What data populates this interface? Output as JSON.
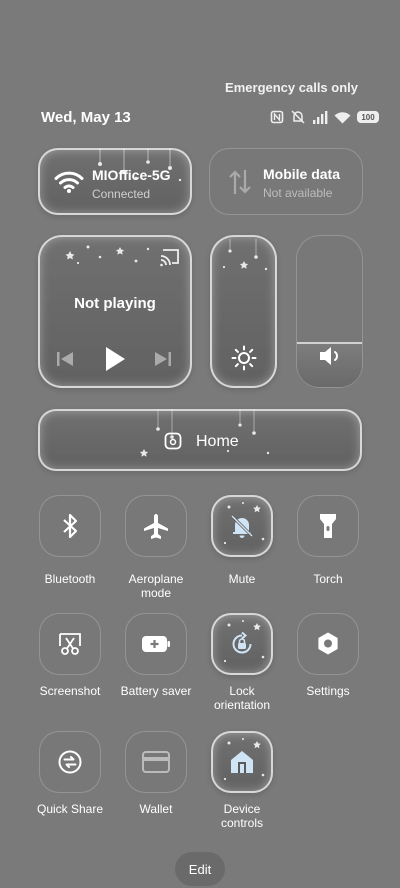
{
  "status": {
    "carrier_text": "Emergency calls only",
    "date": "Wed, May 13",
    "battery": "100"
  },
  "wifi": {
    "name": "MIOffice-5G",
    "status": "Connected"
  },
  "mobile_data": {
    "title": "Mobile data",
    "status": "Not available"
  },
  "media": {
    "status": "Not playing"
  },
  "home": {
    "label": "Home"
  },
  "levels": {
    "brightness": 0.0,
    "volume": 0.2
  },
  "toggles": [
    {
      "label": "Bluetooth",
      "icon": "bluetooth-icon",
      "active": false
    },
    {
      "label": "Aeroplane mode",
      "icon": "airplane-icon",
      "active": false
    },
    {
      "label": "Mute",
      "icon": "bell-off-icon",
      "active": true
    },
    {
      "label": "Torch",
      "icon": "flashlight-icon",
      "active": false
    },
    {
      "label": "Screenshot",
      "icon": "scissors-icon",
      "active": false
    },
    {
      "label": "Battery saver",
      "icon": "battery-plus-icon",
      "active": false
    },
    {
      "label": "Lock orientation",
      "icon": "rotation-lock-icon",
      "active": true
    },
    {
      "label": "Settings",
      "icon": "gear-icon",
      "active": false
    },
    {
      "label": "Quick Share",
      "icon": "share-icon",
      "active": false
    },
    {
      "label": "Wallet",
      "icon": "wallet-icon",
      "active": false
    },
    {
      "label": "Device controls",
      "icon": "home-icon",
      "active": true
    }
  ],
  "edit": {
    "label": "Edit"
  }
}
